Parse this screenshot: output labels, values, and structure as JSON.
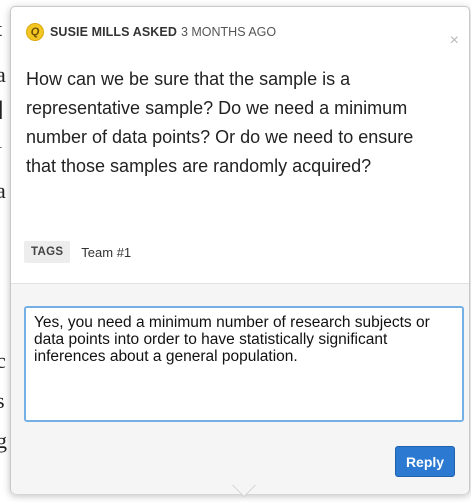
{
  "question": {
    "badge_letter": "Q",
    "asker": "SUSIE MILLS ASKED",
    "time": "3 MONTHS AGO",
    "body": "How can we be sure that the sample is a representative sample? Do we need a minimum number of data points? Or do we need to ensure that those samples are randomly acquired?",
    "close_icon": "×"
  },
  "tags": {
    "label": "TAGS",
    "items": [
      "Team #1"
    ]
  },
  "reply": {
    "value": "Yes, you need a minimum number of research subjects or data points into order to have statistically significant inferences about a general population.",
    "button_label": "Reply"
  },
  "colors": {
    "badge": "#f3c623",
    "reply_button": "#2b79d1",
    "focus_border": "#74afe6"
  }
}
